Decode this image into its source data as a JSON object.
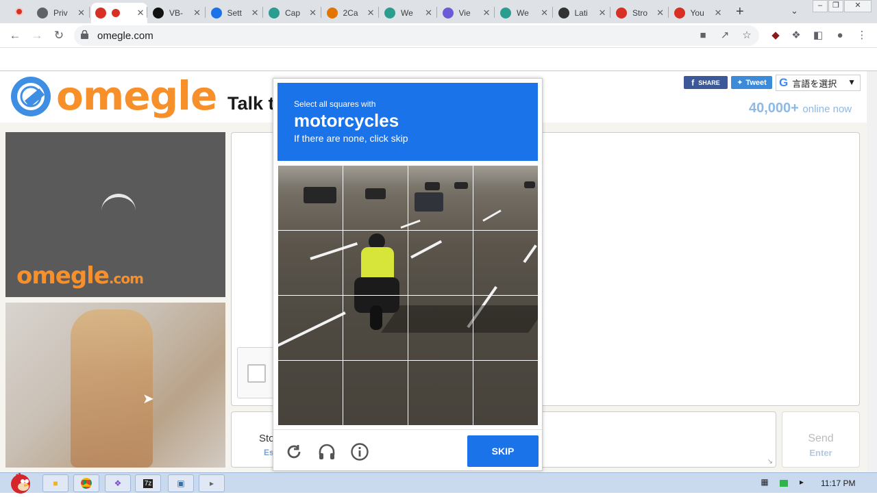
{
  "browser": {
    "tabs": [
      {
        "label": "Priv",
        "color": "#5f6368"
      },
      {
        "label": "",
        "color": "#d93025",
        "active": true
      },
      {
        "label": "VB-",
        "color": "#111111"
      },
      {
        "label": "Sett",
        "color": "#1a73e8"
      },
      {
        "label": "Cap",
        "color": "#2a9d8f"
      },
      {
        "label": "2Ca",
        "color": "#e37400"
      },
      {
        "label": "We",
        "color": "#2a9d8f"
      },
      {
        "label": "Vie",
        "color": "#6b5bd6"
      },
      {
        "label": "We",
        "color": "#2a9d8f"
      },
      {
        "label": "Lati",
        "color": "#333333"
      },
      {
        "label": "Stro",
        "color": "#d93025"
      },
      {
        "label": "You",
        "color": "#d93025"
      }
    ],
    "url": "omegle.com"
  },
  "header": {
    "logo_text": "omegle",
    "tagline": "Talk t",
    "share_label": "SHARE",
    "tweet_label": "Tweet",
    "translate_label": "言語を選択",
    "online_count": "40,000+",
    "online_suffix": "online now"
  },
  "video": {
    "watermark": "omegle",
    "watermark_suffix": ".com"
  },
  "chat": {
    "stop_label": "Sto",
    "stop_hint": "Es",
    "send_label": "Send",
    "send_hint": "Enter"
  },
  "captcha": {
    "instruction_small": "Select all squares with",
    "target": "motorcycles",
    "instruction_sub": "If there are none, click skip",
    "grid_size": 4,
    "skip_label": "SKIP"
  },
  "taskbar": {
    "time": "11:17 PM"
  }
}
